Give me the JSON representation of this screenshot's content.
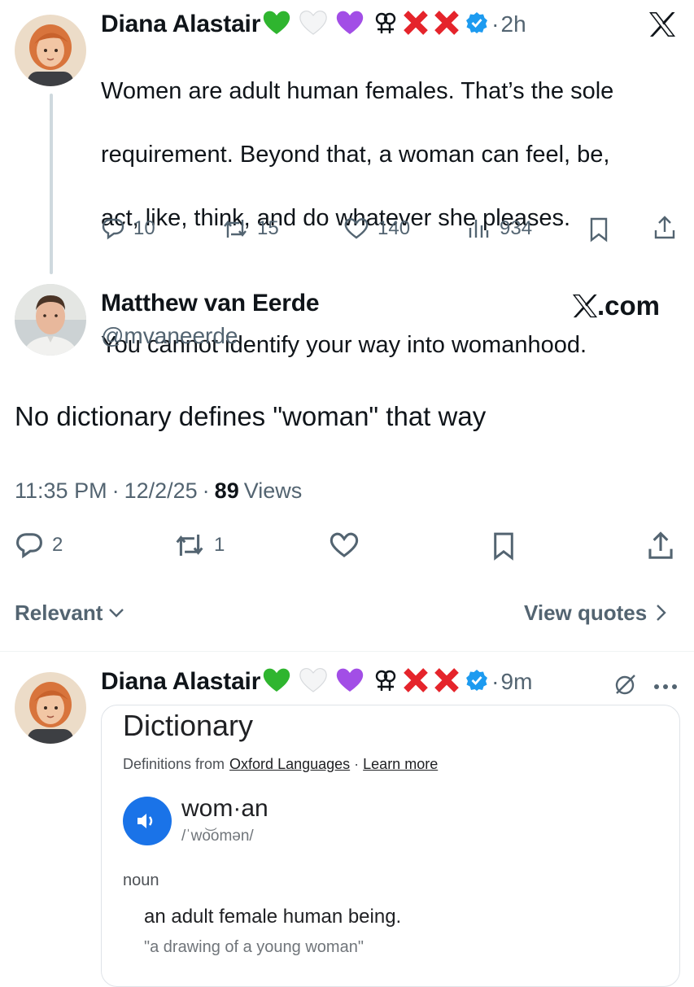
{
  "colors": {
    "text": "#0f1419",
    "muted": "#536471",
    "verified": "#1d9bf0",
    "cross": "#e5242b",
    "green_heart": "#2fb52f",
    "purple_heart": "#a24ee6",
    "google_blue": "#1a73e8"
  },
  "tweet1": {
    "author": "Diana Alastair",
    "separator": "·",
    "time": "2h",
    "text_line1": "Women are adult human females. That’s the sole",
    "text_line2": "requirement. Beyond that, a woman can feel, be,",
    "text_line3": "act, like, think, and do whatever she pleases.",
    "text_line4": "You cannot identify your way into womanhood.",
    "stats": {
      "replies": "10",
      "reposts": "15",
      "likes": "140",
      "views": "934"
    },
    "icons": [
      "green-heart",
      "white-heart",
      "purple-heart",
      "lesbian-symbol",
      "cross-mark",
      "cross-mark",
      "verified-badge",
      "x-logo"
    ]
  },
  "tweet2": {
    "author": "Matthew van Eerde",
    "handle": "@mvaneerde",
    "brand": "X.com",
    "text": "No dictionary defines \"woman\" that way",
    "time": "11:35 PM",
    "date": "12/2/25",
    "views_count": "89",
    "views_label": "Views",
    "stats": {
      "replies": "2",
      "reposts": "1"
    }
  },
  "filters": {
    "relevant": "Relevant",
    "view_quotes": "View quotes"
  },
  "tweet3": {
    "author": "Diana Alastair",
    "separator": "·",
    "time": "9m",
    "card": {
      "title": "Dictionary",
      "source_prefix": "Definitions from",
      "source": "Oxford Languages",
      "source_sep": "·",
      "learn_more": "Learn more",
      "word": "wom·an",
      "phonetic": "/ˈwo͝omən/",
      "part_of_speech": "noun",
      "definition": "an adult female human being.",
      "example": "\"a drawing of a young woman\""
    }
  }
}
